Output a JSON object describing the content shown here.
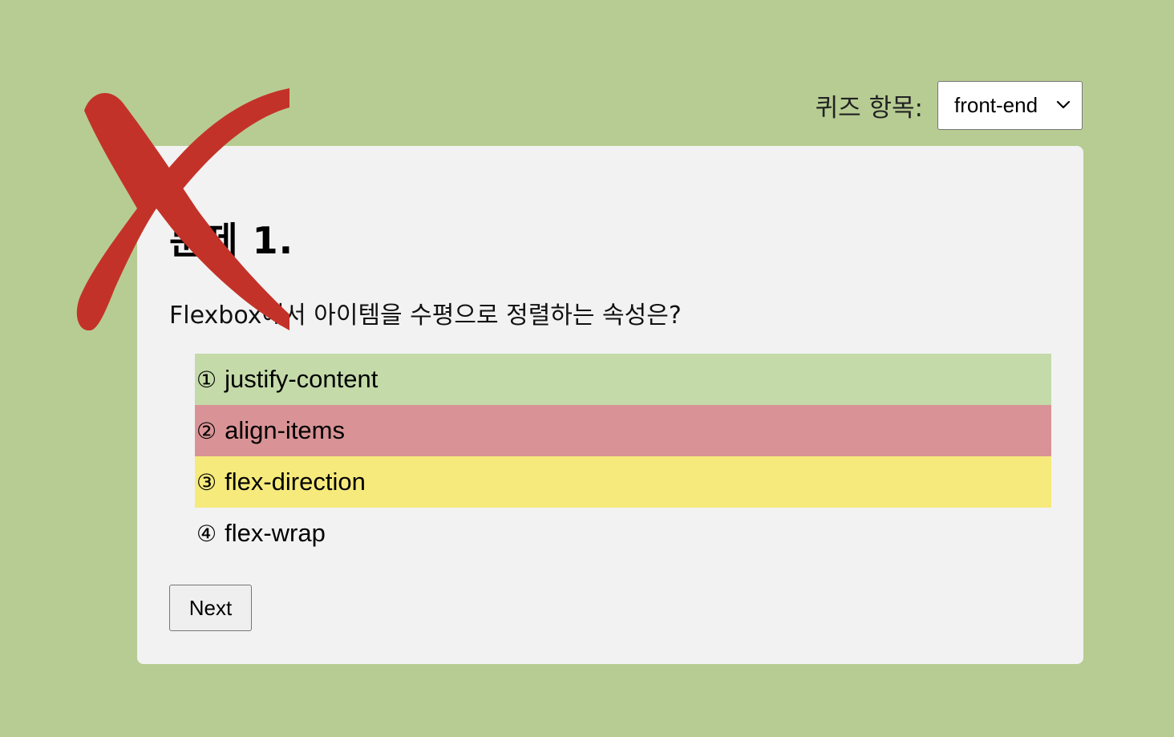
{
  "header": {
    "category_label": "퀴즈 항목:",
    "category_selected": "front-end"
  },
  "quiz": {
    "title": "문제 1.",
    "question": "Flexbox에서 아이템을 수평으로 정렬하는 속성은?",
    "options": [
      {
        "number": "①",
        "label": "justify-content",
        "state": "correct"
      },
      {
        "number": "②",
        "label": "align-items",
        "state": "wrong"
      },
      {
        "number": "③",
        "label": "flex-direction",
        "state": "highlight"
      },
      {
        "number": "④",
        "label": "flex-wrap",
        "state": "none"
      }
    ],
    "next_label": "Next"
  },
  "icons": {
    "wrong_mark": "x-mark-icon",
    "select_arrow": "chevron-down-icon"
  },
  "colors": {
    "background": "#b7cc93",
    "card": "#f2f2f2",
    "correct": "#c4dba9",
    "wrong": "#d99396",
    "highlight": "#f6ea7c",
    "x_mark": "#c33228"
  }
}
